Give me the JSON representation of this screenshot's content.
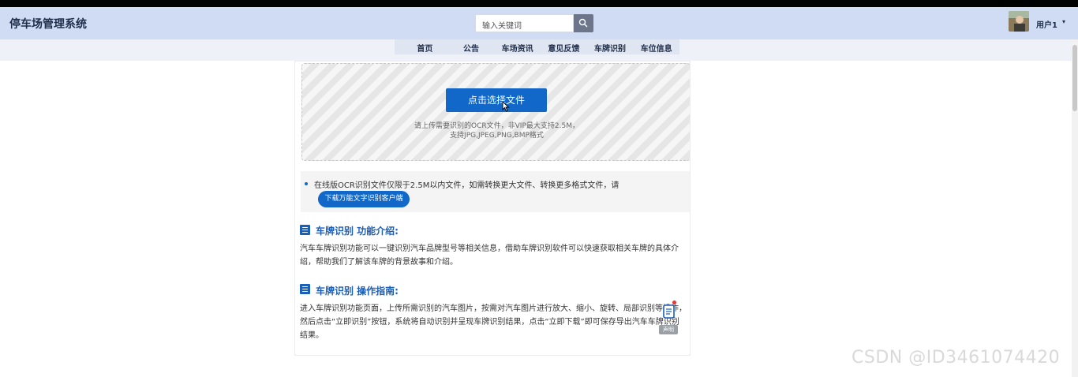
{
  "header": {
    "title": "停车场管理系统",
    "search_placeholder": "输入关键词",
    "user_name": "用户1",
    "caret": "▾"
  },
  "nav": {
    "items": [
      "首页",
      "公告",
      "车场资讯",
      "意见反馈",
      "车牌识别",
      "车位信息"
    ]
  },
  "upload": {
    "button_label": "点击选择文件",
    "hint_line1": "请上传需要识别的OCR文件，非VIP最大支持2.5M，",
    "hint_line2": "支持JPG,JPEG,PNG,BMP格式"
  },
  "notice": {
    "text": "在线版OCR识别文件仅限于2.5M以内文件，如需转换更大文件、转换更多格式文件，请",
    "download_label": "下载万能文字识别客户端"
  },
  "sections": [
    {
      "title": "车牌识别 功能介绍:",
      "body": "汽车车牌识别功能可以一键识别汽车品牌型号等相关信息，借助车牌识别软件可以快速获取相关车牌的具体介绍，帮助我们了解该车牌的背景故事和介绍。"
    },
    {
      "title": "车牌识别 操作指南:",
      "body": "进入车牌识别功能页面，上传所需识别的汽车图片，按需对汽车图片进行放大、缩小、旋转、局部识别等操作，然后点击“立即识别”按钮，系统将自动识别并呈现车牌识别结果，点击“立即下载”即可保存导出汽车车牌识别结果。"
    }
  ],
  "float": {
    "label": "声明"
  },
  "watermark": "CSDN @ID3461074420",
  "colors": {
    "header_bg": "#cfdcf4",
    "accent": "#1168c9",
    "section_title": "#1c5fb8"
  }
}
